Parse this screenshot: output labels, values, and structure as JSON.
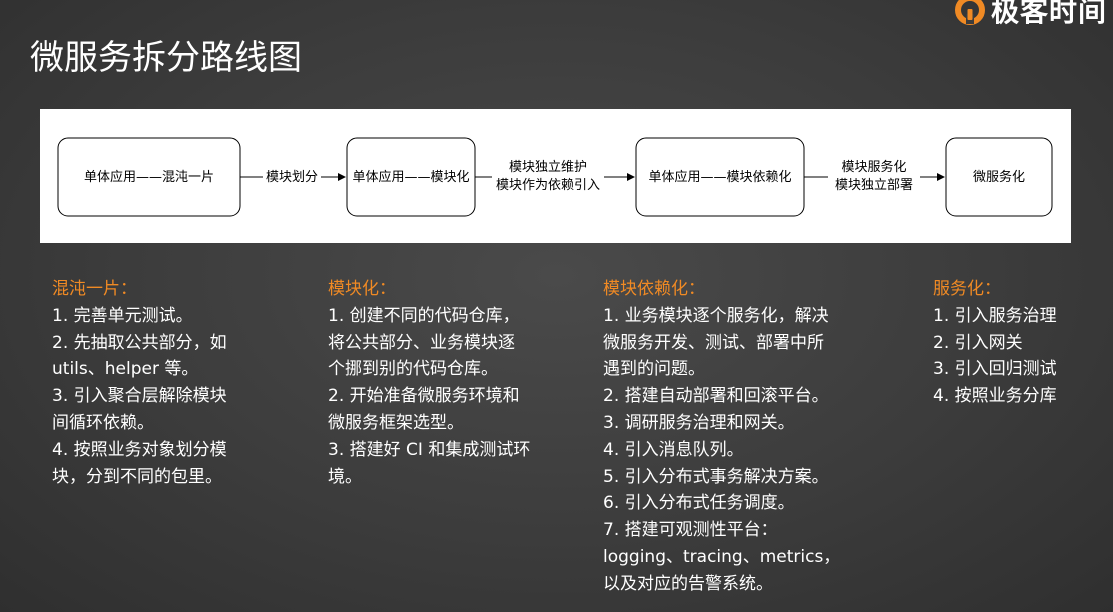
{
  "brand": {
    "name": "极客时间",
    "accent": "#f08a24"
  },
  "title": "微服务拆分路线图",
  "diagram": {
    "stages": [
      "单体应用——混沌一片",
      "单体应用——模块化",
      "单体应用——模块依赖化",
      "微服务化"
    ],
    "arrows": [
      {
        "line1": "模块划分",
        "line2": ""
      },
      {
        "line1": "模块独立维护",
        "line2": "模块作为依赖引入"
      },
      {
        "line1": "模块服务化",
        "line2": "模块独立部署"
      }
    ]
  },
  "columns": [
    {
      "heading": "混沌一片：",
      "items": [
        "1. 完善单元测试。",
        "2. 先抽取公共部分，如\nutils、helper 等。",
        "3. 引入聚合层解除模块\n间循环依赖。",
        "4. 按照业务对象划分模\n块，分到不同的包里。"
      ]
    },
    {
      "heading": "模块化：",
      "items": [
        "1. 创建不同的代码仓库，\n将公共部分、业务模块逐\n个挪到别的代码仓库。",
        "2. 开始准备微服务环境和\n微服务框架选型。",
        "3. 搭建好 CI 和集成测试环\n境。"
      ]
    },
    {
      "heading": "模块依赖化：",
      "items": [
        "1. 业务模块逐个服务化，解决\n微服务开发、测试、部署中所\n遇到的问题。",
        "2. 搭建自动部署和回滚平台。",
        "3. 调研服务治理和网关。",
        "4. 引入消息队列。",
        "5. 引入分布式事务解决方案。",
        "6. 引入分布式任务调度。",
        "7. 搭建可观测性平台：\nlogging、tracing、metrics，\n以及对应的告警系统。"
      ]
    },
    {
      "heading": "服务化：",
      "items": [
        "1. 引入服务治理",
        "2. 引入网关",
        "3. 引入回归测试",
        "4. 按照业务分库"
      ]
    }
  ]
}
